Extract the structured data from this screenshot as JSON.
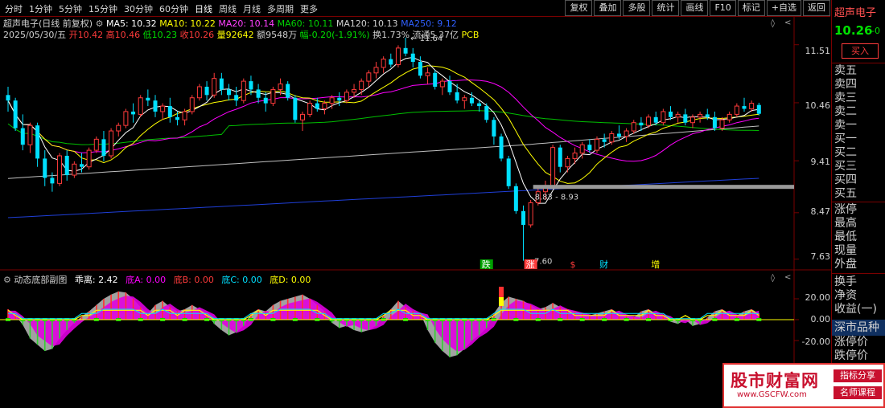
{
  "menu": {
    "items": [
      "分时",
      "1分钟",
      "5分钟",
      "15分钟",
      "30分钟",
      "60分钟",
      "日线",
      "周线",
      "月线",
      "多周期",
      "更多"
    ],
    "active_index": 6,
    "tools": [
      "复权",
      "叠加",
      "多股",
      "统计",
      "画线",
      "F10",
      "标记",
      "+自选",
      "返回"
    ]
  },
  "info": {
    "title": "超声电子(日线 前复权)",
    "ma5": "MA5: 10.32",
    "ma10": "MA10: 10.22",
    "ma20": "MA20: 10.14",
    "ma60": "MA60: 10.11",
    "ma120": "MA120: 10.13",
    "ma250": "MA250: 9.12",
    "date": "2025/05/30/五",
    "open": "开10.42",
    "high": "高10.46",
    "low": "低10.23",
    "close": "收10.26",
    "vol": "量92642",
    "amount": "额9548万",
    "change": "幅-0.20(-1.91%)",
    "turnover": "换1.73%",
    "float": "流通5.37亿",
    "pcb": "PCB"
  },
  "colors": {
    "up": "#ff3b3b",
    "down": "#00e0ff",
    "ma5": "#ffffff",
    "ma10": "#ffff00",
    "ma20": "#ff00ff",
    "ma60": "#00c000",
    "ma120": "#c0c0c0",
    "ma250": "#1f3fd8"
  },
  "chart_data": {
    "type": "candlestick",
    "y_ticks": [
      "11.51",
      "10.46",
      "9.41",
      "8.47",
      "7.63"
    ],
    "y_range": [
      7.45,
      12.0
    ],
    "annotations": {
      "high": "11.64",
      "low": "7.60",
      "band": "8.83 - 8.93",
      "markers": [
        "跌",
        "涨",
        "$",
        "财",
        "增"
      ]
    },
    "candles": [
      [
        10.6,
        10.75,
        10.3,
        10.5
      ],
      [
        10.5,
        10.55,
        9.95,
        10.0
      ],
      [
        10.0,
        10.25,
        9.6,
        9.7
      ],
      [
        9.7,
        10.1,
        9.55,
        10.05
      ],
      [
        10.05,
        10.1,
        9.3,
        9.45
      ],
      [
        9.45,
        9.6,
        8.95,
        9.1
      ],
      [
        9.1,
        9.2,
        8.85,
        9.0
      ],
      [
        9.0,
        9.55,
        8.95,
        9.5
      ],
      [
        9.5,
        9.6,
        9.05,
        9.15
      ],
      [
        9.15,
        9.4,
        9.1,
        9.35
      ],
      [
        9.35,
        9.55,
        9.2,
        9.3
      ],
      [
        9.3,
        9.65,
        9.25,
        9.6
      ],
      [
        9.6,
        9.85,
        9.55,
        9.8
      ],
      [
        9.8,
        9.95,
        9.4,
        9.5
      ],
      [
        9.5,
        10.0,
        9.45,
        9.95
      ],
      [
        9.95,
        10.1,
        9.85,
        10.05
      ],
      [
        10.05,
        10.35,
        10.0,
        10.3
      ],
      [
        10.3,
        10.45,
        10.1,
        10.25
      ],
      [
        10.25,
        10.6,
        10.2,
        10.55
      ],
      [
        10.55,
        10.7,
        10.4,
        10.5
      ],
      [
        10.5,
        10.6,
        10.2,
        10.3
      ],
      [
        10.3,
        10.45,
        10.15,
        10.4
      ],
      [
        10.4,
        10.55,
        10.1,
        10.2
      ],
      [
        10.2,
        10.3,
        10.05,
        10.15
      ],
      [
        10.15,
        10.35,
        10.05,
        10.3
      ],
      [
        10.3,
        10.6,
        10.25,
        10.55
      ],
      [
        10.55,
        10.8,
        10.5,
        10.75
      ],
      [
        10.75,
        10.85,
        10.5,
        10.6
      ],
      [
        10.6,
        11.0,
        10.55,
        10.9
      ],
      [
        10.9,
        11.0,
        10.6,
        10.7
      ],
      [
        10.7,
        10.8,
        10.5,
        10.6
      ],
      [
        10.6,
        10.75,
        10.4,
        10.5
      ],
      [
        10.5,
        10.9,
        10.45,
        10.85
      ],
      [
        10.85,
        10.95,
        10.6,
        10.7
      ],
      [
        10.7,
        10.8,
        10.45,
        10.55
      ],
      [
        10.55,
        10.65,
        10.3,
        10.45
      ],
      [
        10.45,
        10.75,
        10.4,
        10.7
      ],
      [
        10.7,
        10.9,
        10.6,
        10.8
      ],
      [
        10.8,
        10.85,
        10.5,
        10.55
      ],
      [
        10.55,
        10.6,
        10.1,
        10.15
      ],
      [
        10.15,
        10.3,
        9.95,
        10.25
      ],
      [
        10.25,
        10.5,
        10.2,
        10.45
      ],
      [
        10.45,
        10.55,
        10.3,
        10.35
      ],
      [
        10.35,
        10.5,
        10.25,
        10.45
      ],
      [
        10.45,
        10.6,
        10.35,
        10.55
      ],
      [
        10.55,
        10.65,
        10.4,
        10.5
      ],
      [
        10.5,
        10.7,
        10.45,
        10.65
      ],
      [
        10.65,
        10.8,
        10.55,
        10.7
      ],
      [
        10.7,
        10.9,
        10.6,
        10.85
      ],
      [
        10.85,
        11.05,
        10.75,
        11.0
      ],
      [
        11.0,
        11.2,
        10.9,
        11.1
      ],
      [
        11.1,
        11.3,
        11.0,
        11.25
      ],
      [
        11.25,
        11.35,
        11.1,
        11.15
      ],
      [
        11.15,
        11.5,
        11.1,
        11.45
      ],
      [
        11.45,
        11.64,
        11.3,
        11.35
      ],
      [
        11.35,
        11.45,
        11.1,
        11.2
      ],
      [
        11.2,
        11.3,
        10.9,
        10.95
      ],
      [
        10.95,
        11.1,
        10.8,
        11.0
      ],
      [
        11.0,
        11.05,
        10.7,
        10.75
      ],
      [
        10.75,
        10.9,
        10.6,
        10.85
      ],
      [
        10.85,
        10.95,
        10.6,
        10.65
      ],
      [
        10.65,
        10.8,
        10.45,
        10.5
      ],
      [
        10.5,
        10.6,
        10.35,
        10.55
      ],
      [
        10.55,
        10.65,
        10.4,
        10.45
      ],
      [
        10.45,
        10.5,
        10.3,
        10.4
      ],
      [
        10.4,
        10.45,
        10.1,
        10.15
      ],
      [
        10.15,
        10.2,
        9.7,
        9.85
      ],
      [
        9.85,
        9.9,
        9.4,
        9.45
      ],
      [
        9.45,
        9.5,
        8.9,
        8.95
      ],
      [
        8.95,
        9.0,
        8.45,
        8.5
      ],
      [
        8.5,
        8.6,
        7.6,
        8.25
      ],
      [
        8.25,
        8.7,
        8.2,
        8.65
      ],
      [
        8.65,
        8.95,
        8.6,
        8.85
      ],
      [
        8.85,
        9.05,
        8.7,
        8.95
      ],
      [
        8.95,
        9.7,
        8.9,
        9.65
      ],
      [
        9.65,
        9.7,
        9.2,
        9.3
      ],
      [
        9.3,
        9.5,
        9.2,
        9.45
      ],
      [
        9.45,
        9.65,
        9.35,
        9.55
      ],
      [
        9.55,
        9.75,
        9.45,
        9.7
      ],
      [
        9.7,
        9.8,
        9.55,
        9.6
      ],
      [
        9.6,
        9.85,
        9.55,
        9.8
      ],
      [
        9.8,
        9.9,
        9.65,
        9.75
      ],
      [
        9.75,
        9.95,
        9.7,
        9.9
      ],
      [
        9.9,
        10.05,
        9.8,
        9.85
      ],
      [
        9.85,
        10.0,
        9.75,
        9.95
      ],
      [
        9.95,
        10.15,
        9.9,
        10.1
      ],
      [
        10.1,
        10.2,
        9.95,
        10.05
      ],
      [
        10.05,
        10.25,
        10.0,
        10.2
      ],
      [
        10.2,
        10.3,
        10.05,
        10.1
      ],
      [
        10.1,
        10.35,
        10.05,
        10.3
      ],
      [
        10.3,
        10.4,
        10.15,
        10.2
      ],
      [
        10.2,
        10.3,
        10.1,
        10.25
      ],
      [
        10.25,
        10.35,
        10.05,
        10.1
      ],
      [
        10.1,
        10.25,
        10.0,
        10.2
      ],
      [
        10.2,
        10.3,
        10.1,
        10.25
      ],
      [
        10.25,
        10.35,
        10.15,
        10.2
      ],
      [
        10.2,
        10.3,
        9.95,
        10.0
      ],
      [
        10.0,
        10.2,
        9.95,
        10.15
      ],
      [
        10.15,
        10.3,
        10.1,
        10.25
      ],
      [
        10.25,
        10.45,
        10.2,
        10.4
      ],
      [
        10.4,
        10.55,
        10.3,
        10.35
      ],
      [
        10.35,
        10.5,
        10.3,
        10.45
      ],
      [
        10.42,
        10.46,
        10.23,
        10.26
      ]
    ],
    "sub_indicator": {
      "title": "动态底部副图",
      "items": [
        "乖离: 2.42",
        "底A: 0.00",
        "底B: 0.00",
        "底C: 0.00",
        "底D: 0.00"
      ],
      "y_ticks": [
        "20.00",
        "0.00",
        "-20.00"
      ],
      "values": [
        10,
        4,
        -5,
        -18,
        -24,
        -30,
        -28,
        -18,
        -10,
        -3,
        3,
        8,
        14,
        20,
        24,
        27,
        26,
        20,
        12,
        6,
        14,
        18,
        12,
        8,
        10,
        14,
        10,
        6,
        -4,
        -10,
        -15,
        -12,
        -6,
        6,
        10,
        8,
        14,
        18,
        20,
        22,
        24,
        20,
        14,
        8,
        -3,
        -8,
        -6,
        -10,
        -12,
        -10,
        -6,
        4,
        10,
        18,
        12,
        8,
        6,
        -10,
        -22,
        -30,
        -36,
        -34,
        -28,
        -20,
        -15,
        -8,
        6,
        16,
        22,
        20,
        18,
        14,
        10,
        12,
        16,
        12,
        10,
        8,
        6,
        4,
        6,
        8,
        10,
        6,
        4,
        2,
        8,
        10,
        6,
        4,
        -2,
        -4,
        0,
        -6,
        -4,
        2,
        8,
        10,
        6,
        4,
        8,
        10,
        6
      ]
    }
  },
  "sidepanel": {
    "name": "超声电子",
    "price": "10.26",
    "price_change": "-0",
    "buy_label": "买入",
    "orderbook": [
      "卖五",
      "卖四",
      "卖三",
      "卖二",
      "卖一",
      "买一",
      "买二",
      "买三",
      "买四",
      "买五"
    ],
    "stats": [
      "涨停",
      "最高",
      "最低",
      "现量",
      "外盘"
    ],
    "stats2": [
      "换手",
      "净资",
      "收益(一)"
    ],
    "market_label": "深市品种",
    "stats3": [
      "涨停价",
      "跌停价"
    ]
  },
  "brand": {
    "main": "股市财富网",
    "url": "www.GSCFW.com",
    "tag1": "指标分享",
    "tag2": "名师课程"
  }
}
